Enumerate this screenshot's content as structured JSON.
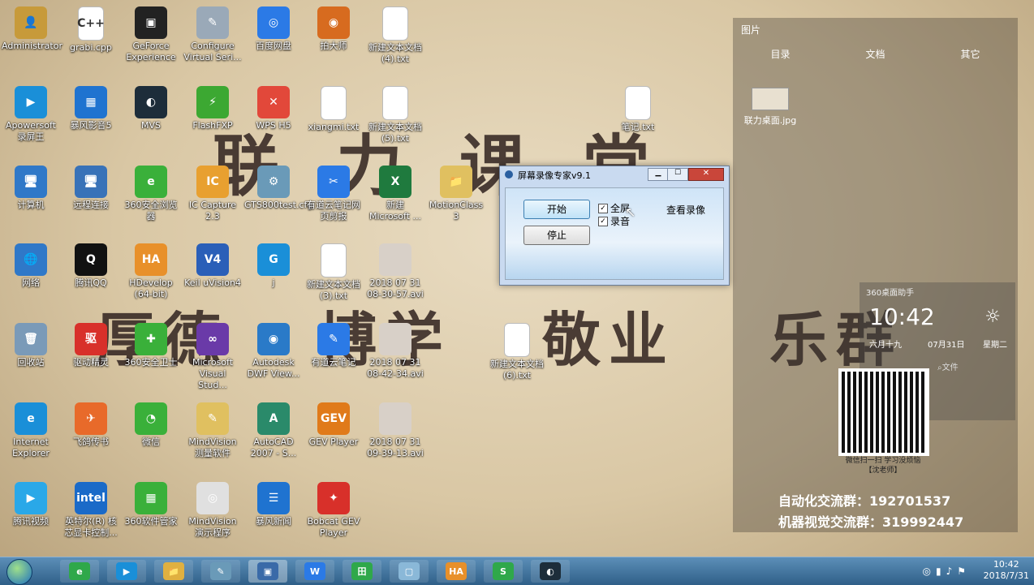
{
  "desktop_icons": [
    {
      "label": "Administrator",
      "color": "#c79a3a",
      "glyph": "👤"
    },
    {
      "label": "grabi.cpp",
      "color": "#ffffff",
      "glyph": "C++"
    },
    {
      "label": "GeForce Experience",
      "color": "#222222",
      "glyph": "▣"
    },
    {
      "label": "Configure Virtual Seri...",
      "color": "#9aa9b8",
      "glyph": "✎"
    },
    {
      "label": "百度网盘",
      "color": "#2b7ae6",
      "glyph": "◎"
    },
    {
      "label": "拍大师",
      "color": "#d76b1f",
      "glyph": "◉"
    },
    {
      "label": "新建文本文档 (4).txt",
      "color": "#ffffff",
      "glyph": ""
    },
    {
      "label": "Apowersoft 录屏王",
      "color": "#1a8fd8",
      "glyph": "▶"
    },
    {
      "label": "暴风影音5",
      "color": "#1f73d0",
      "glyph": "▦"
    },
    {
      "label": "MVS",
      "color": "#1d2d3a",
      "glyph": "◐"
    },
    {
      "label": "FlashFXP",
      "color": "#3ca832",
      "glyph": "⚡"
    },
    {
      "label": "WPS H5",
      "color": "#e2483a",
      "glyph": "✕"
    },
    {
      "label": "xiangmi.txt",
      "color": "#ffffff",
      "glyph": ""
    },
    {
      "label": "新建文本文档 (5).txt",
      "color": "#ffffff",
      "glyph": ""
    },
    {
      "label": "笔记.txt",
      "color": "#ffffff",
      "glyph": ""
    },
    {
      "label": "计算机",
      "color": "#2f78c8",
      "glyph": "🖥"
    },
    {
      "label": "远程连接",
      "color": "#3872b8",
      "glyph": "🖥"
    },
    {
      "label": "360安全浏览器",
      "color": "#3ab03a",
      "glyph": "e"
    },
    {
      "label": "IC Capture 2.3",
      "color": "#e8a030",
      "glyph": "IC"
    },
    {
      "label": "GTS800test.cfg",
      "color": "#6a9ab8",
      "glyph": "⚙"
    },
    {
      "label": "有道云笔记网页剪报",
      "color": "#2b7ae6",
      "glyph": "✂"
    },
    {
      "label": "新建 Microsoft ...",
      "color": "#1f7a3e",
      "glyph": "X"
    },
    {
      "label": "MotionClass 3",
      "color": "#e0c060",
      "glyph": "📁"
    },
    {
      "label": "网络",
      "color": "#2f78c8",
      "glyph": "🌐"
    },
    {
      "label": "腾讯QQ",
      "color": "#111111",
      "glyph": "Q"
    },
    {
      "label": "HDevelop (64-bit)",
      "color": "#e8902a",
      "glyph": "HA"
    },
    {
      "label": "Keil uVision4",
      "color": "#2a5fb8",
      "glyph": "V4"
    },
    {
      "label": "j",
      "color": "#1a8fd8",
      "glyph": "G"
    },
    {
      "label": "新建文本文档 (3).txt",
      "color": "#ffffff",
      "glyph": ""
    },
    {
      "label": "2018 07 31 08-30-57.avi",
      "color": "#d8d0c8",
      "glyph": ""
    },
    {
      "label": "回收站",
      "color": "#7a9ab8",
      "glyph": "🗑"
    },
    {
      "label": "驱动精灵",
      "color": "#d8302a",
      "glyph": "驱"
    },
    {
      "label": "360安全卫士",
      "color": "#3ab03a",
      "glyph": "✚"
    },
    {
      "label": "Microsoft Visual Stud...",
      "color": "#6a3aa8",
      "glyph": "∞"
    },
    {
      "label": "Autodesk DWF View...",
      "color": "#2a7ac8",
      "glyph": "◉"
    },
    {
      "label": "有道云笔记",
      "color": "#2b7ae6",
      "glyph": "✎"
    },
    {
      "label": "2018 07 31 08-42-34.avi",
      "color": "#d8d0c8",
      "glyph": ""
    },
    {
      "label": "新建文本文档 (6).txt",
      "color": "#ffffff",
      "glyph": ""
    },
    {
      "label": "Internet Explorer",
      "color": "#1a8fd8",
      "glyph": "e"
    },
    {
      "label": "飞鸽传书",
      "color": "#e86a2a",
      "glyph": "✈"
    },
    {
      "label": "微信",
      "color": "#3ab03a",
      "glyph": "◔"
    },
    {
      "label": "MindVision 测量软件",
      "color": "#e0c060",
      "glyph": "✎"
    },
    {
      "label": "AutoCAD 2007 - S...",
      "color": "#2a8a6a",
      "glyph": "A"
    },
    {
      "label": "GEV Player",
      "color": "#e07a1a",
      "glyph": "GEV"
    },
    {
      "label": "2018 07 31 09-39-13.avi",
      "color": "#d8d0c8",
      "glyph": ""
    },
    {
      "label": "腾讯视频",
      "color": "#2aa8e8",
      "glyph": "▶"
    },
    {
      "label": "英特尔(R) 核芯显卡控制...",
      "color": "#1a6ac8",
      "glyph": "intel"
    },
    {
      "label": "360软件管家",
      "color": "#3ab03a",
      "glyph": "▦"
    },
    {
      "label": "MindVision 演示程序",
      "color": "#e0e0e0",
      "glyph": "◎"
    },
    {
      "label": "暴风新闻",
      "color": "#1f73d0",
      "glyph": "☰"
    },
    {
      "label": "Bobcat GEV Player",
      "color": "#d8302a",
      "glyph": "✦"
    }
  ],
  "watermark": {
    "line1": "联力课堂",
    "line2_a": "厚德",
    "line2_b": "博学",
    "line2_c": "敬业",
    "line2_d": "乐群"
  },
  "panel": {
    "title": "图片",
    "tabs": [
      "目录",
      "文档",
      "其它"
    ],
    "file_label": "联力桌面.jpg",
    "assistant_title": "360桌面助手",
    "clock": "10:42",
    "lunar": "六月十九",
    "date": "07月31日",
    "weekday": "星期二",
    "search_label": "文件",
    "qr_caption1": "微信扫一扫 学习没烦恼",
    "qr_caption2": "【沈老师】",
    "group1": "自动化交流群：192701537",
    "group2": "机器视觉交流群：319992447"
  },
  "dialog": {
    "title": "屏幕录像专家v9.1",
    "start_label": "开始",
    "stop_label": "停止",
    "fullscreen_label": "全屏",
    "audio_label": "录音",
    "view_label": "查看录像",
    "fullscreen_checked": true,
    "audio_checked": true
  },
  "taskbar": {
    "time": "10:42",
    "date": "2018/7/31",
    "apps": [
      "360浏览器",
      "Apowersoft",
      "资源管理器",
      "画图",
      "屏幕录像",
      "WPS",
      "WPS表格",
      "记事本",
      "HDevelop",
      "WPS演示",
      "MVS"
    ]
  }
}
